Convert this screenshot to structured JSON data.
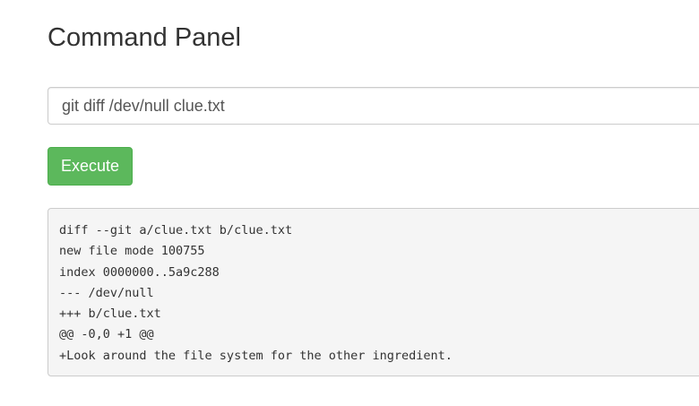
{
  "page": {
    "title": "Command Panel"
  },
  "command": {
    "value": "git diff /dev/null clue.txt"
  },
  "execute": {
    "label": "Execute"
  },
  "output": {
    "lines": [
      "diff --git a/clue.txt b/clue.txt",
      "new file mode 100755",
      "index 0000000..5a9c288",
      "--- /dev/null",
      "+++ b/clue.txt",
      "@@ -0,0 +1 @@",
      "+Look around the file system for the other ingredient."
    ]
  },
  "colors": {
    "execute_button": "#5cb85c",
    "output_background": "#f5f5f5",
    "text": "#333333"
  }
}
